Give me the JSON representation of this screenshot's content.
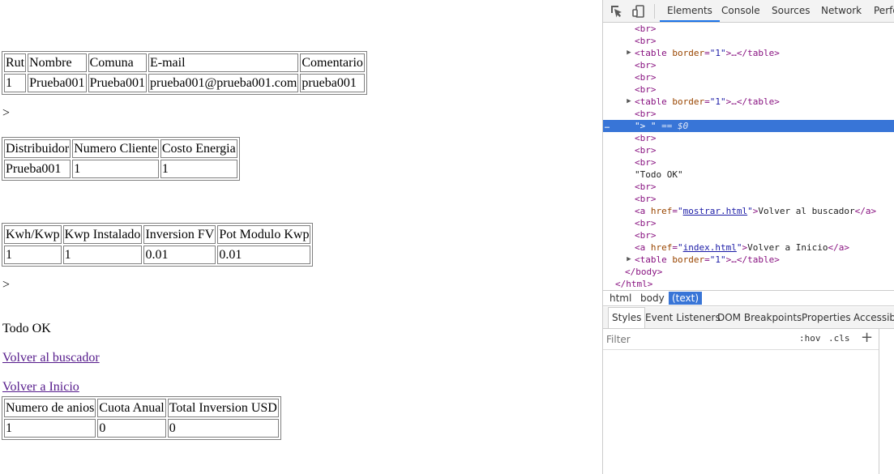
{
  "page": {
    "table1": {
      "headers": [
        "Rut",
        "Nombre",
        "Comuna",
        "E-mail",
        "Comentario"
      ],
      "row": [
        "1",
        "Prueba001",
        "Prueba001",
        "prueba001@prueba001.com",
        "prueba001"
      ]
    },
    "stray1": ">",
    "table2": {
      "headers": [
        "Distribuidor",
        "Numero Cliente",
        "Costo Energia"
      ],
      "row": [
        "Prueba001",
        "1",
        "1"
      ]
    },
    "table3": {
      "headers": [
        "Kwh/Kwp",
        "Kwp Instalado",
        "Inversion FV",
        "Pot Modulo Kwp"
      ],
      "row": [
        "1",
        "1",
        "0.01",
        "0.01"
      ]
    },
    "stray2": ">",
    "status": "Todo OK",
    "link_buscador": "Volver al buscador",
    "link_inicio": "Volver a Inicio",
    "table4": {
      "headers": [
        "Numero de anios",
        "Cuota Anual",
        "Total Inversion USD"
      ],
      "row": [
        "1",
        "0",
        "0"
      ]
    }
  },
  "devtools": {
    "tabs": [
      "Elements",
      "Console",
      "Sources",
      "Network",
      "Perfo"
    ],
    "active_tab": "Elements",
    "icons": [
      "inspect-icon",
      "device-toggle-icon"
    ],
    "dom": {
      "br": "<br>",
      "table_open": "<table",
      "table_attr": "border",
      "table_eq": "=",
      "table_val": "\"1\"",
      "table_close": ">…</table>",
      "selected_text": "\"> \"",
      "selected_suffix": "== $0",
      "todo_ok": "\"Todo OK\"",
      "a_open": "<a",
      "a_attr": "href",
      "a1_href": "mostrar.html",
      "a1_text": "Volver al buscador",
      "a2_href": "index.html",
      "a2_text": "Volver a Inicio",
      "a_close": "</a>",
      "q": "\"",
      "gt": ">",
      "body_close": "</body>",
      "html_close": "</html>",
      "dots": "…"
    },
    "breadcrumbs": [
      "html",
      "body",
      "(text)"
    ],
    "active_crumb": "(text)",
    "subtabs": [
      "Styles",
      "Event Listeners",
      "DOM Breakpoints",
      "Properties",
      "Accessibili"
    ],
    "active_subtab": "Styles",
    "filter_placeholder": "Filter",
    "hov": ":hov",
    "cls": ".cls",
    "plus": "+"
  }
}
